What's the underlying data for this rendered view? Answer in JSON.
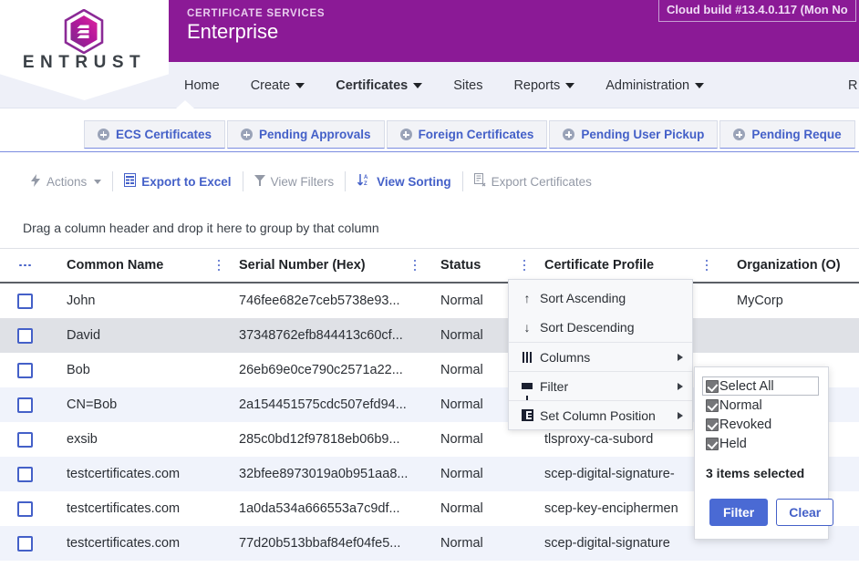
{
  "brand": {
    "logo_word": "ENTRUST",
    "logo_icon": "entrust-hexagon-logo",
    "eyebrow": "CERTIFICATE SERVICES",
    "title": "Enterprise",
    "cloud_build": "Cloud build #13.4.0.117 (Mon No",
    "purple": "#8B1A96",
    "accent_blue": "#4460c8"
  },
  "nav": {
    "items": [
      {
        "label": "Home",
        "has_caret": false,
        "active": false
      },
      {
        "label": "Create",
        "has_caret": true,
        "active": false
      },
      {
        "label": "Certificates",
        "has_caret": true,
        "active": true
      },
      {
        "label": "Sites",
        "has_caret": false,
        "active": false
      },
      {
        "label": "Reports",
        "has_caret": true,
        "active": false
      },
      {
        "label": "Administration",
        "has_caret": true,
        "active": false
      }
    ],
    "partial_item": "R"
  },
  "tabs": [
    {
      "label": "ECS Certificates",
      "icon": "plus-circle-icon"
    },
    {
      "label": "Pending Approvals",
      "icon": "plus-circle-icon"
    },
    {
      "label": "Foreign Certificates",
      "icon": "plus-circle-icon"
    },
    {
      "label": "Pending User Pickup",
      "icon": "plus-circle-icon"
    },
    {
      "label": "Pending Reque",
      "icon": "plus-circle-icon"
    }
  ],
  "toolbar": {
    "actions_label": "Actions",
    "export_excel_label": "Export to Excel",
    "view_filters_label": "View Filters",
    "view_sorting_label": "View Sorting",
    "export_certificates_label": "Export Certificates",
    "actions_icon": "bolt-icon",
    "export_excel_icon": "excel-file-icon",
    "view_filters_icon": "funnel-icon",
    "view_sorting_icon": "sort-az-icon",
    "export_certificates_icon": "certificate-export-icon"
  },
  "groupbar": {
    "hint": "Drag a column header and drop it here to group by that column"
  },
  "grid": {
    "row_menu_icon": "ellipsis-horizontal-icon",
    "column_menu_icon": "kebab-menu-icon",
    "columns": [
      "Common Name",
      "Serial Number (Hex)",
      "Status",
      "Certificate Profile",
      "Organization (O)"
    ],
    "rows": [
      {
        "common_name": "John",
        "serial": "746fee682e7ceb5738e93...",
        "status": "Normal",
        "profile": "",
        "organization": "MyCorp"
      },
      {
        "common_name": "David",
        "serial": "37348762efb844413c60cf...",
        "status": "Normal",
        "profile": "",
        "organization": ""
      },
      {
        "common_name": "Bob",
        "serial": "26eb69e0ce790c2571a22...",
        "status": "Normal",
        "profile": "",
        "organization": ""
      },
      {
        "common_name": "CN=Bob",
        "serial": "2a154451575cdc507efd94...",
        "status": "Normal",
        "profile": "",
        "organization": ""
      },
      {
        "common_name": "exsib",
        "serial": "285c0bd12f97818eb06b9...",
        "status": "Normal",
        "profile": "tlsproxy-ca-subord",
        "organization": ""
      },
      {
        "common_name": "testcertificates.com",
        "serial": "32bfee8973019a0b951aa8...",
        "status": "Normal",
        "profile": "scep-digital-signature-",
        "organization": ""
      },
      {
        "common_name": "testcertificates.com",
        "serial": "1a0da534a666553a7c9df...",
        "status": "Normal",
        "profile": "scep-key-enciphermen",
        "organization": ""
      },
      {
        "common_name": "testcertificates.com",
        "serial": "77d20b513bbaf84ef04fe5...",
        "status": "Normal",
        "profile": "scep-digital-signature",
        "organization": ""
      }
    ]
  },
  "context_menu": {
    "items": [
      {
        "label": "Sort Ascending",
        "icon": "arrow-up-icon",
        "submenu": false
      },
      {
        "label": "Sort Descending",
        "icon": "arrow-down-icon",
        "submenu": false
      },
      {
        "label": "Columns",
        "icon": "columns-bars-icon",
        "submenu": true
      },
      {
        "label": "Filter",
        "icon": "funnel-icon",
        "submenu": true
      },
      {
        "label": "Set Column Position",
        "icon": "column-position-icon",
        "submenu": true
      }
    ]
  },
  "filter_panel": {
    "options": [
      {
        "label": "Select All",
        "checked": true,
        "focused": true
      },
      {
        "label": "Normal",
        "checked": true,
        "focused": false
      },
      {
        "label": "Revoked",
        "checked": true,
        "focused": false
      },
      {
        "label": "Held",
        "checked": true,
        "focused": false
      }
    ],
    "count_text": "3 items selected",
    "filter_button": "Filter",
    "clear_button": "Clear",
    "filter_button_color": "#4a6ad4"
  }
}
